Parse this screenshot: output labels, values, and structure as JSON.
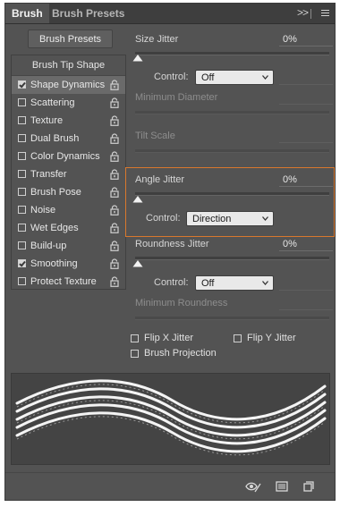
{
  "tabs": {
    "brush": "Brush",
    "brush_presets": "Brush Presets",
    "menu_glyph": ">>"
  },
  "brush_presets_button": "Brush Presets",
  "list": {
    "header": "Brush Tip Shape",
    "items": [
      {
        "label": "Shape Dynamics",
        "checked": true,
        "selected": true
      },
      {
        "label": "Scattering",
        "checked": false
      },
      {
        "label": "Texture",
        "checked": false
      },
      {
        "label": "Dual Brush",
        "checked": false
      },
      {
        "label": "Color Dynamics",
        "checked": false
      },
      {
        "label": "Transfer",
        "checked": false
      },
      {
        "label": "Brush Pose",
        "checked": false
      },
      {
        "label": "Noise",
        "checked": false
      },
      {
        "label": "Wet Edges",
        "checked": false
      },
      {
        "label": "Build-up",
        "checked": false
      },
      {
        "label": "Smoothing",
        "checked": true
      },
      {
        "label": "Protect Texture",
        "checked": false
      }
    ]
  },
  "settings": {
    "size_jitter": {
      "label": "Size Jitter",
      "value": "0%",
      "control_label": "Control:",
      "control_value": "Off"
    },
    "minimum_diameter": {
      "label": "Minimum Diameter"
    },
    "tilt_scale": {
      "label": "Tilt Scale"
    },
    "angle_jitter": {
      "label": "Angle Jitter",
      "value": "0%",
      "control_label": "Control:",
      "control_value": "Direction"
    },
    "roundness_jitter": {
      "label": "Roundness Jitter",
      "value": "0%",
      "control_label": "Control:",
      "control_value": "Off"
    },
    "minimum_roundness": {
      "label": "Minimum Roundness"
    }
  },
  "options": {
    "flip_x": "Flip X Jitter",
    "flip_y": "Flip Y Jitter",
    "brush_projection": "Brush Projection"
  },
  "colors": {
    "highlight_border": "#d9782d",
    "panel_bg": "#535353"
  }
}
